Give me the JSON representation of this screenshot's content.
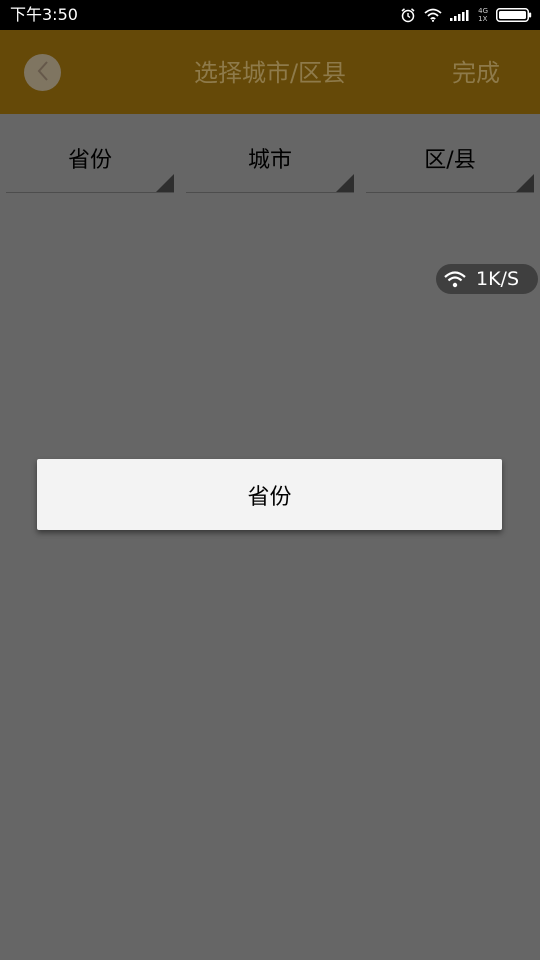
{
  "status_bar": {
    "time": "下午3:50",
    "network_top": "4G",
    "network_bottom": "1X",
    "icons": [
      "alarm-icon",
      "wifi-icon",
      "signal-icon",
      "battery-icon"
    ]
  },
  "header": {
    "title": "选择城市/区县",
    "done_label": "完成",
    "back_icon": "chevron-left-icon",
    "background_color": "#654908"
  },
  "spinners": [
    {
      "label": "省份"
    },
    {
      "label": "城市"
    },
    {
      "label": "区/县"
    }
  ],
  "speed_badge": {
    "text": "1K/S",
    "icon": "wifi-icon"
  },
  "dropdown": {
    "options": [
      "省份"
    ]
  },
  "colors": {
    "overlay_background": "#666666",
    "popup_background": "#f3f3f3"
  }
}
